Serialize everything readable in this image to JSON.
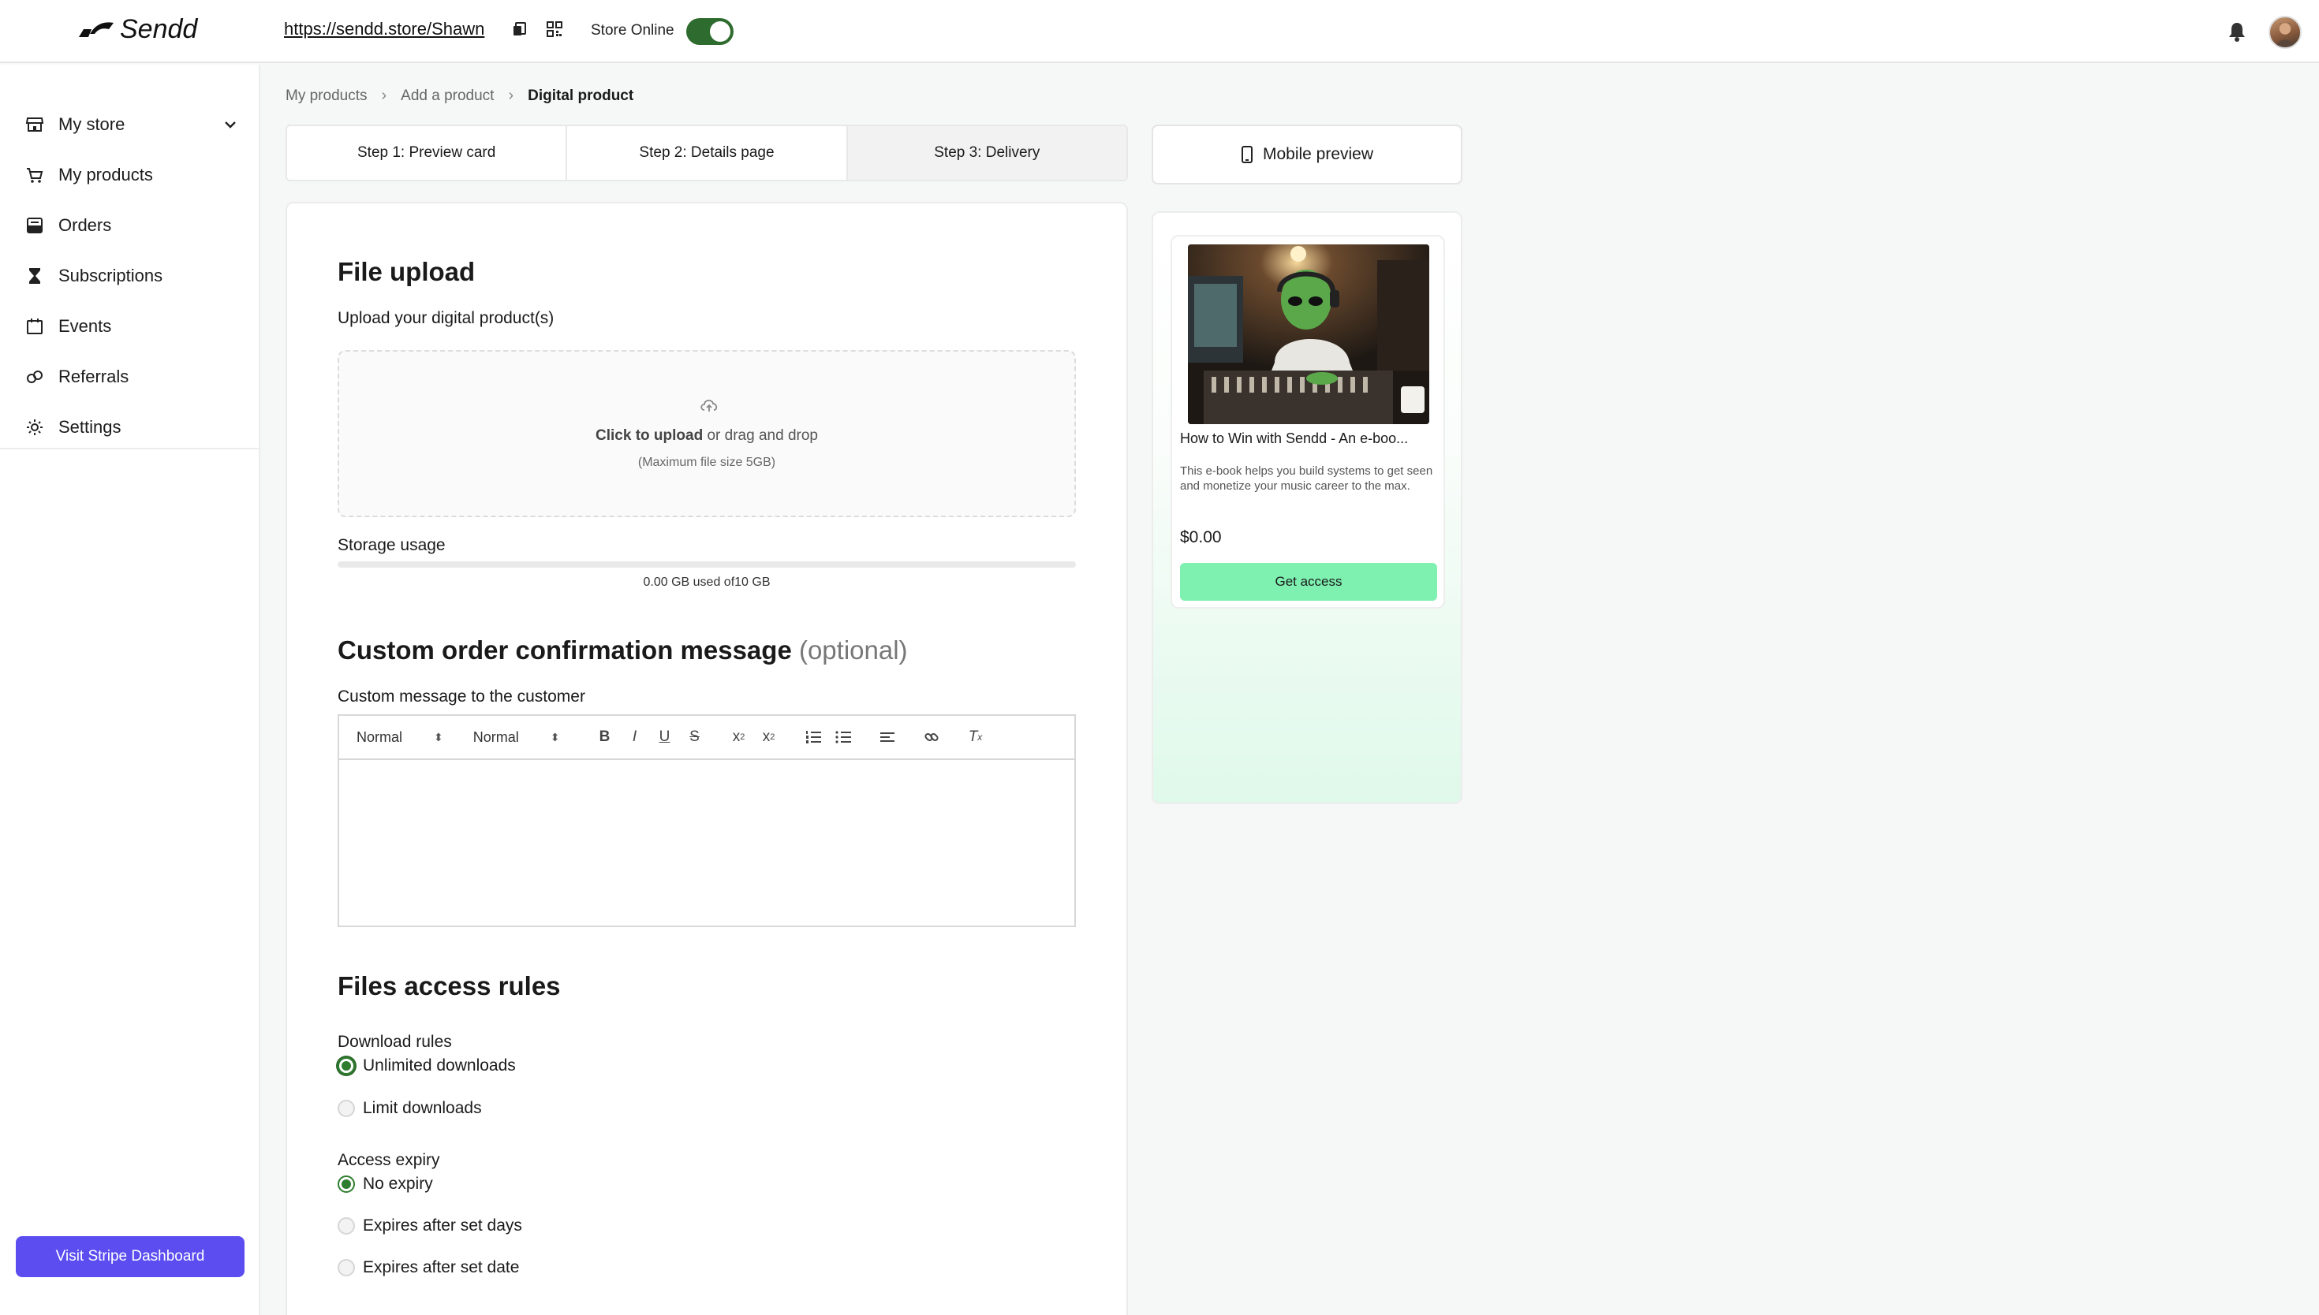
{
  "app": {
    "logo_text": "Sendd",
    "store_url": "https://sendd.store/Shawn",
    "store_online_label": "Store Online",
    "store_online": true
  },
  "sidebar": {
    "items": [
      {
        "label": "My store",
        "icon": "storefront-icon",
        "has_chevron": true
      },
      {
        "label": "My products",
        "icon": "cart-icon"
      },
      {
        "label": "Orders",
        "icon": "orders-icon"
      },
      {
        "label": "Subscriptions",
        "icon": "hourglass-icon"
      },
      {
        "label": "Events",
        "icon": "calendar-icon"
      },
      {
        "label": "Referrals",
        "icon": "link-icon"
      },
      {
        "label": "Settings",
        "icon": "gear-icon"
      }
    ],
    "stripe_button": "Visit Stripe Dashboard"
  },
  "breadcrumb": [
    "My products",
    "Add a product",
    "Digital product"
  ],
  "steps": [
    "Step 1: Preview card",
    "Step 2: Details page",
    "Step 3: Delivery"
  ],
  "file_upload": {
    "heading": "File upload",
    "label": "Upload your digital product(s)",
    "click_text": "Click to upload",
    "drag_text": " or drag and drop",
    "max_size": "(Maximum file size 5GB)",
    "storage_label": "Storage usage",
    "storage_text": "0.00 GB used of10 GB",
    "storage_fraction": 0.0
  },
  "confirmation": {
    "heading": "Custom order confirmation message",
    "optional": "(optional)",
    "label": "Custom message to the customer",
    "toolbar": {
      "font_select": "Normal",
      "size_select": "Normal"
    }
  },
  "access_rules": {
    "heading": "Files access rules",
    "download_label": "Download rules",
    "download_options": [
      "Unlimited downloads",
      "Limit downloads"
    ],
    "download_selected": 0,
    "expiry_label": "Access expiry",
    "expiry_options": [
      "No expiry",
      "Expires after set days",
      "Expires after set date"
    ],
    "expiry_selected": 0
  },
  "preview": {
    "button_label": "Mobile preview",
    "card": {
      "title": "How to Win with Sendd - An e-boo...",
      "description": "This e-book helps you build systems to get seen and monetize your music career to the max.",
      "price": "$0.00",
      "button": "Get access"
    }
  },
  "colors": {
    "accent_green": "#2e6b2e",
    "stripe_purple": "#5b4df0",
    "cta_mint": "#7ef0b0"
  }
}
